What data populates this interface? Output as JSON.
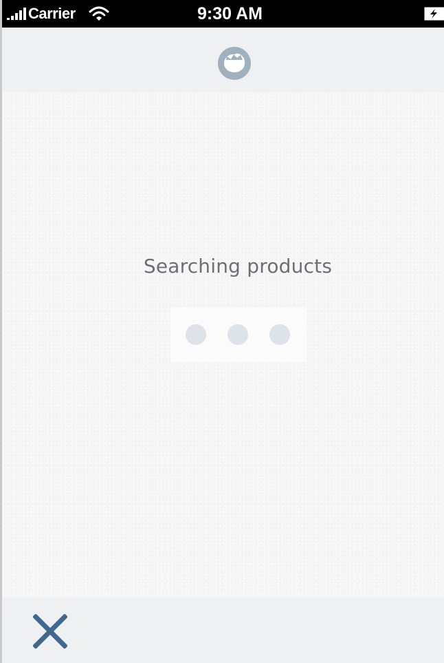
{
  "status_bar": {
    "carrier": "Carrier",
    "time": "9:30 AM",
    "signal_icon": "signal-bars-icon",
    "wifi_icon": "wifi-icon",
    "battery_icon": "battery-charging-icon"
  },
  "header": {
    "logo_icon": "app-logo-icon"
  },
  "main": {
    "status_text": "Searching products",
    "loading_indicator": "three-dots"
  },
  "toolbar": {
    "close_icon": "close-icon"
  },
  "colors": {
    "status_bar_bg": "#000000",
    "header_bg": "#eef0f2",
    "content_bg": "#f6f6f6",
    "logo_grey": "#9fb0be",
    "text_grey": "#6c6f73",
    "dot_grey": "#dde3e8",
    "close_blue": "#41698f"
  }
}
